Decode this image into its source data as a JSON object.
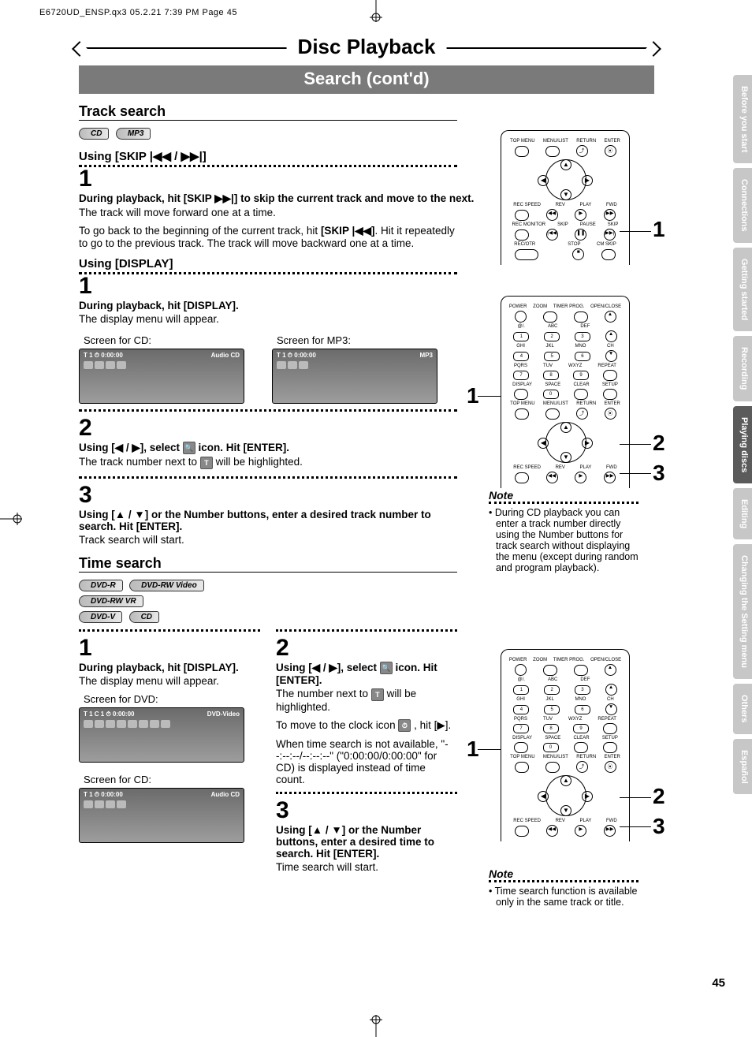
{
  "header_line": "E6720UD_ENSP.qx3  05.2.21 7:39 PM  Page 45",
  "main_title": "Disc Playback",
  "subtitle": "Search (cont'd)",
  "track_search": {
    "heading": "Track search",
    "badges": [
      "CD",
      "MP3"
    ],
    "using_skip": "Using [SKIP |◀◀ / ▶▶|]",
    "step1_num": "1",
    "step1_bold": "During playback, hit [SKIP ▶▶|] to skip the current track and move to the next.",
    "step1_reg": "The track will move forward one at a time.",
    "step1_extra1": "To go back to the beginning of the current track, hit ",
    "step1_extra_bold": "[SKIP |◀◀]",
    "step1_extra2": ". Hit it repeatedly to go to the previous track. The track will move backward one at a time.",
    "using_display": "Using [DISPLAY]",
    "d1_num": "1",
    "d1_bold": "During playback, hit [DISPLAY].",
    "d1_reg": "The display menu will appear.",
    "screen_cd_cap": "Screen for CD:",
    "screen_mp3_cap": "Screen for MP3:",
    "screen_cd": {
      "left": "T  1  ⏱ 0:00:00",
      "right": "Audio CD"
    },
    "screen_mp3": {
      "left": "T  1  ⏱ 0:00:00",
      "right": "MP3"
    },
    "d2_num": "2",
    "d2_bold_a": "Using [◀ / ▶], select ",
    "d2_bold_b": " icon. Hit [ENTER].",
    "d2_reg_a": "The track number next to ",
    "d2_reg_b": " will be highlighted.",
    "d3_num": "3",
    "d3_bold": "Using [▲ / ▼] or the Number buttons, enter a desired track number to search. Hit [ENTER].",
    "d3_reg": "Track search will start."
  },
  "time_search": {
    "heading": "Time search",
    "badges_row1": [
      "DVD-R",
      "DVD-RW Video",
      "DVD-RW VR"
    ],
    "badges_row2": [
      "DVD-V",
      "CD"
    ],
    "left": {
      "s1_num": "1",
      "s1_bold": "During playback, hit [DISPLAY].",
      "s1_reg": "The display menu will appear.",
      "screen_dvd_cap": "Screen for DVD:",
      "screen_dvd": {
        "left": "T  1  C 1  ⏱ 0:00:00",
        "right": "DVD-Video"
      },
      "screen_cd_cap": "Screen for CD:",
      "screen_cd": {
        "left": "T  1  ⏱ 0:00:00",
        "right": "Audio CD"
      }
    },
    "right": {
      "s2_num": "2",
      "s2_bold_a": "Using [◀ / ▶], select ",
      "s2_bold_b": " icon. Hit [ENTER].",
      "s2_reg_a": "The number next to ",
      "s2_reg_b": " will be highlighted.",
      "s2_extra1": "To move to the clock icon ",
      "s2_extra2": " , hit [▶].",
      "s2_extra3": "When time search is not available, \"--:--:--/--:--:--\" (\"0:00:00/0:00:00\" for CD) is displayed instead of time count.",
      "s3_num": "3",
      "s3_bold": "Using [▲ / ▼] or the Number buttons, enter a desired time to search. Hit [ENTER].",
      "s3_reg": "Time search will start."
    }
  },
  "remote1": {
    "row1": [
      "TOP MENU",
      "MENU/LIST",
      "RETURN",
      "ENTER"
    ],
    "row2": [
      "REC SPEED",
      "REV",
      "PLAY",
      "FWD"
    ],
    "row3": [
      "REC MONITOR",
      "SKIP",
      "PAUSE",
      "SKIP"
    ],
    "row4": [
      "REC/OTR",
      "",
      "STOP",
      "CM SKIP"
    ]
  },
  "remote2": {
    "top": [
      "POWER",
      "ZOOM",
      "TIMER PROG.",
      "OPEN/CLOSE"
    ],
    "numrow_lbl": [
      [
        "@/.",
        "ABC",
        "DEF",
        ""
      ],
      [
        "GHI",
        "JKL",
        "MNO",
        "CH"
      ],
      [
        "PQRS",
        "TUV",
        "WXYZ",
        "REPEAT"
      ]
    ],
    "numrow": [
      [
        "1",
        "2",
        "3",
        "▲"
      ],
      [
        "4",
        "5",
        "6",
        "▼"
      ],
      [
        "7",
        "8",
        "9",
        ""
      ]
    ],
    "row_ds": [
      "DISPLAY",
      "SPACE",
      "CLEAR",
      "SETUP"
    ],
    "row_ds_btn": [
      "",
      "0",
      "",
      ""
    ],
    "row_tm": [
      "TOP MENU",
      "MENU/LIST",
      "RETURN",
      "ENTER"
    ],
    "row_rs": [
      "REC SPEED",
      "REV",
      "PLAY",
      "FWD"
    ]
  },
  "note1": {
    "title": "Note",
    "text": "• During CD playback you can enter a track number directly using the Number buttons for track search without displaying the menu (except during random and program playback)."
  },
  "note2": {
    "title": "Note",
    "text": "• Time search function is available only in the same track or title."
  },
  "side_tabs": [
    "Before you start",
    "Connections",
    "Getting started",
    "Recording",
    "Playing discs",
    "Editing",
    "Changing the Setting menu",
    "Others",
    "Español"
  ],
  "active_tab_index": 4,
  "page_number": "45",
  "callouts": {
    "r1_1": "1",
    "r2_1": "1",
    "r2_2": "2",
    "r2_3": "3",
    "r3_1": "1",
    "r3_2": "2",
    "r3_3": "3"
  }
}
